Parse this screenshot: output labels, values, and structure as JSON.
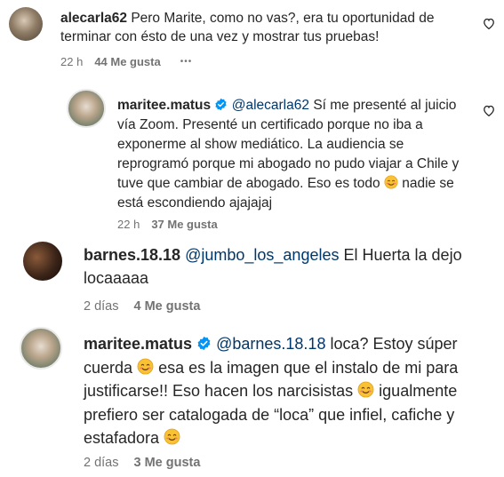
{
  "comments": [
    {
      "username": "alecarla62",
      "text": "Pero Marite, como no vas?, era tu oportunidad de terminar con ésto de una vez y mostrar tus pruebas!",
      "time": "22 h",
      "likes": "44 Me gusta",
      "more": "•••"
    },
    {
      "username": "maritee.matus",
      "verified": true,
      "mention": "@alecarla62",
      "text": "Sí me presenté al juicio vía Zoom. Presenté un certificado porque no iba a exponerme al show mediático. La audiencia se reprogramó porque mi abogado no pudo viajar a Chile y tuve que cambiar de abogado. Eso es todo",
      "emoji_name": "smiling-face-emoji",
      "text_after": "nadie se está escondiendo ajajajaj",
      "time": "22 h",
      "likes": "37 Me gusta"
    },
    {
      "username": "barnes.18.18",
      "mention": "@jumbo_los_angeles",
      "text": "El Huerta la dejo locaaaaa",
      "time": "2 días",
      "likes": "4 Me gusta"
    },
    {
      "username": "maritee.matus",
      "verified": true,
      "mention": "@barnes.18.18",
      "text_1": "loca? Estoy súper cuerda",
      "text_2": "esa es la imagen que el instalo de mi para justificarse!! Eso hacen los narcisistas",
      "text_3": "igualmente prefiero ser catalogada de “loca” que infiel, cafiche y estafadora",
      "time": "2 días",
      "likes": "3 Me gusta"
    }
  ],
  "colors": {
    "text": "#262626",
    "mention": "#00376b",
    "meta": "#737373",
    "verified": "#0095f6"
  }
}
